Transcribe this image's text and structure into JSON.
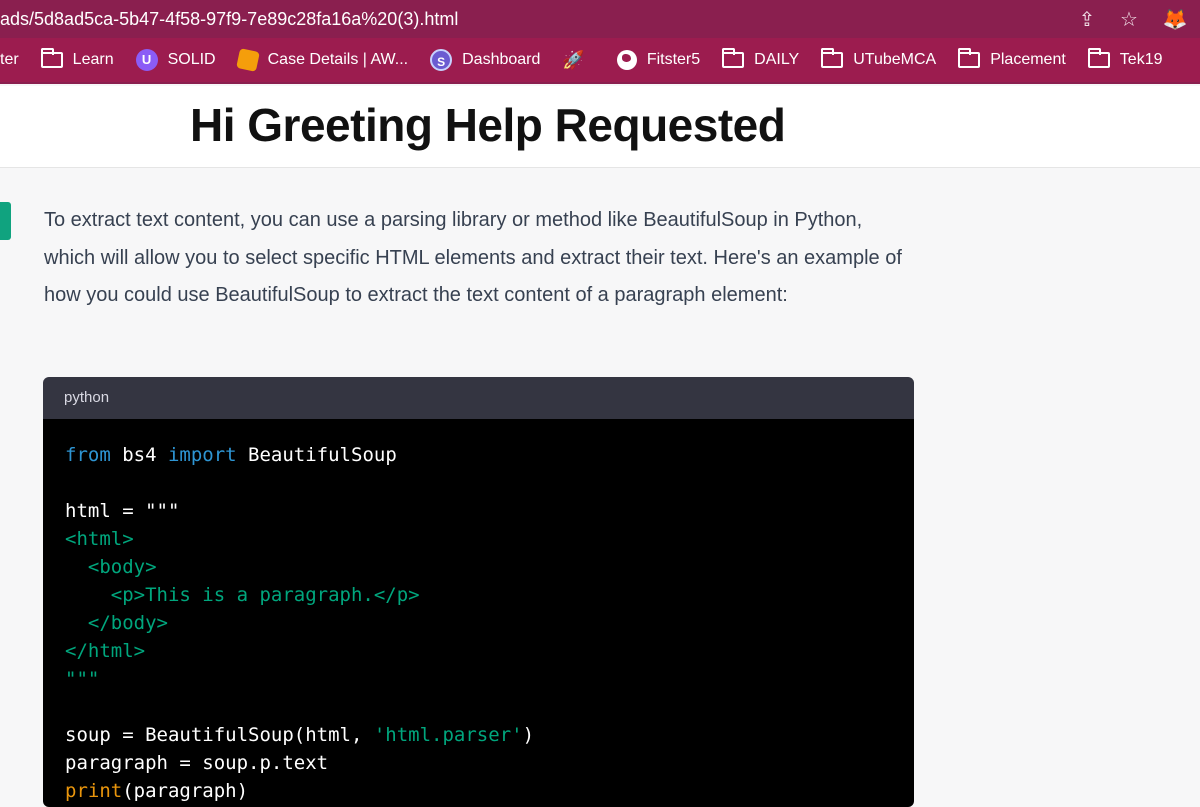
{
  "browser": {
    "url": "ads/5d8ad5ca-5b47-4f58-97f9-7e89c28fa16a%20(3).html",
    "icons": {
      "share": "share-icon",
      "star": "bookmark-star-icon",
      "extension": "metamask-fox-icon"
    }
  },
  "bookmarks": [
    {
      "label": "ter",
      "icon": "none"
    },
    {
      "label": "Learn",
      "icon": "folder-icon"
    },
    {
      "label": "SOLID",
      "icon": "solid-logo-icon"
    },
    {
      "label": "Case Details | AW...",
      "icon": "aws-box-icon"
    },
    {
      "label": "Dashboard",
      "icon": "dashboard-logo-icon"
    },
    {
      "label": "",
      "icon": "rocket-icon"
    },
    {
      "label": "Fitster5",
      "icon": "globe-icon"
    },
    {
      "label": "DAILY",
      "icon": "folder-icon"
    },
    {
      "label": "UTubeMCA",
      "icon": "folder-icon"
    },
    {
      "label": "Placement",
      "icon": "folder-icon"
    },
    {
      "label": "Tek19",
      "icon": "folder-icon"
    }
  ],
  "page": {
    "title": "Hi Greeting Help Requested"
  },
  "answer": {
    "text": "To extract text content, you can use a parsing library or method like BeautifulSoup in Python, which will allow you to select specific HTML elements and extract their text. Here's an example of how you could use BeautifulSoup to extract the text content of a paragraph element:"
  },
  "code": {
    "language": "python",
    "lines": [
      "from bs4 import BeautifulSoup",
      "",
      "html = \"\"\"",
      "<html>",
      "  <body>",
      "    <p>This is a paragraph.</p>",
      "  </body>",
      "</html>",
      "\"\"\"",
      "",
      "soup = BeautifulSoup(html, 'html.parser')",
      "paragraph = soup.p.text",
      "print(paragraph)"
    ]
  },
  "colors": {
    "chrome": "#8a1f4f",
    "bookmarks_bar": "#9c1c4f",
    "accent": "#10a37f",
    "code_bg": "#000000",
    "keyword": "#2e95d3",
    "string": "#00a67d",
    "builtin": "#e9950c"
  }
}
